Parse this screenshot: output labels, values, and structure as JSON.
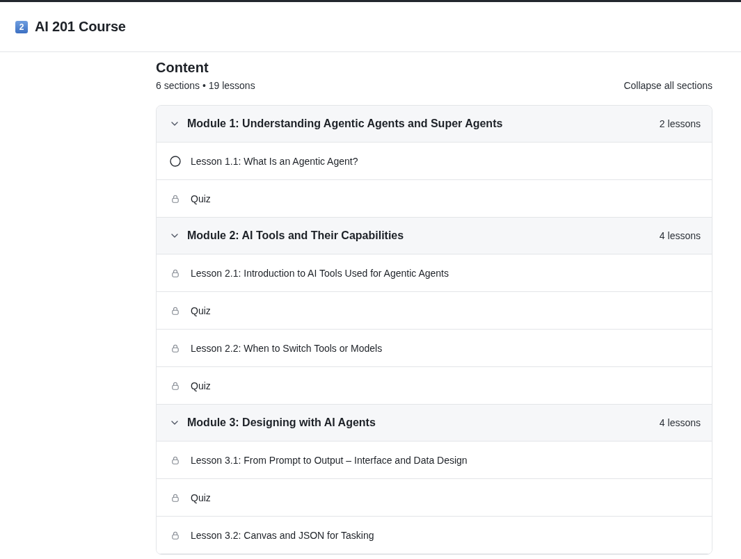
{
  "header": {
    "badge": "2",
    "title": "AI 201 Course"
  },
  "content": {
    "heading": "Content",
    "summary": "6 sections • 19 lessons",
    "collapse_action": "Collapse all sections"
  },
  "modules": [
    {
      "title": "Module 1: Understanding Agentic Agents and Super Agents",
      "count": "2 lessons",
      "expanded": true,
      "lessons": [
        {
          "title": "Lesson 1.1: What Is an Agentic Agent?",
          "locked": false
        },
        {
          "title": "Quiz",
          "locked": true
        }
      ]
    },
    {
      "title": "Module 2: AI Tools and Their Capabilities",
      "count": "4 lessons",
      "expanded": true,
      "lessons": [
        {
          "title": "Lesson 2.1: Introduction to AI Tools Used for Agentic Agents",
          "locked": true
        },
        {
          "title": "Quiz",
          "locked": true
        },
        {
          "title": "Lesson 2.2: When to Switch Tools or Models",
          "locked": true
        },
        {
          "title": "Quiz",
          "locked": true
        }
      ]
    },
    {
      "title": "Module 3: Designing with AI Agents",
      "count": "4 lessons",
      "expanded": true,
      "lessons": [
        {
          "title": "Lesson 3.1: From Prompt to Output – Interface and Data Design",
          "locked": true
        },
        {
          "title": "Quiz",
          "locked": true
        },
        {
          "title": "Lesson 3.2: Canvas and JSON for Tasking",
          "locked": true
        }
      ]
    }
  ]
}
